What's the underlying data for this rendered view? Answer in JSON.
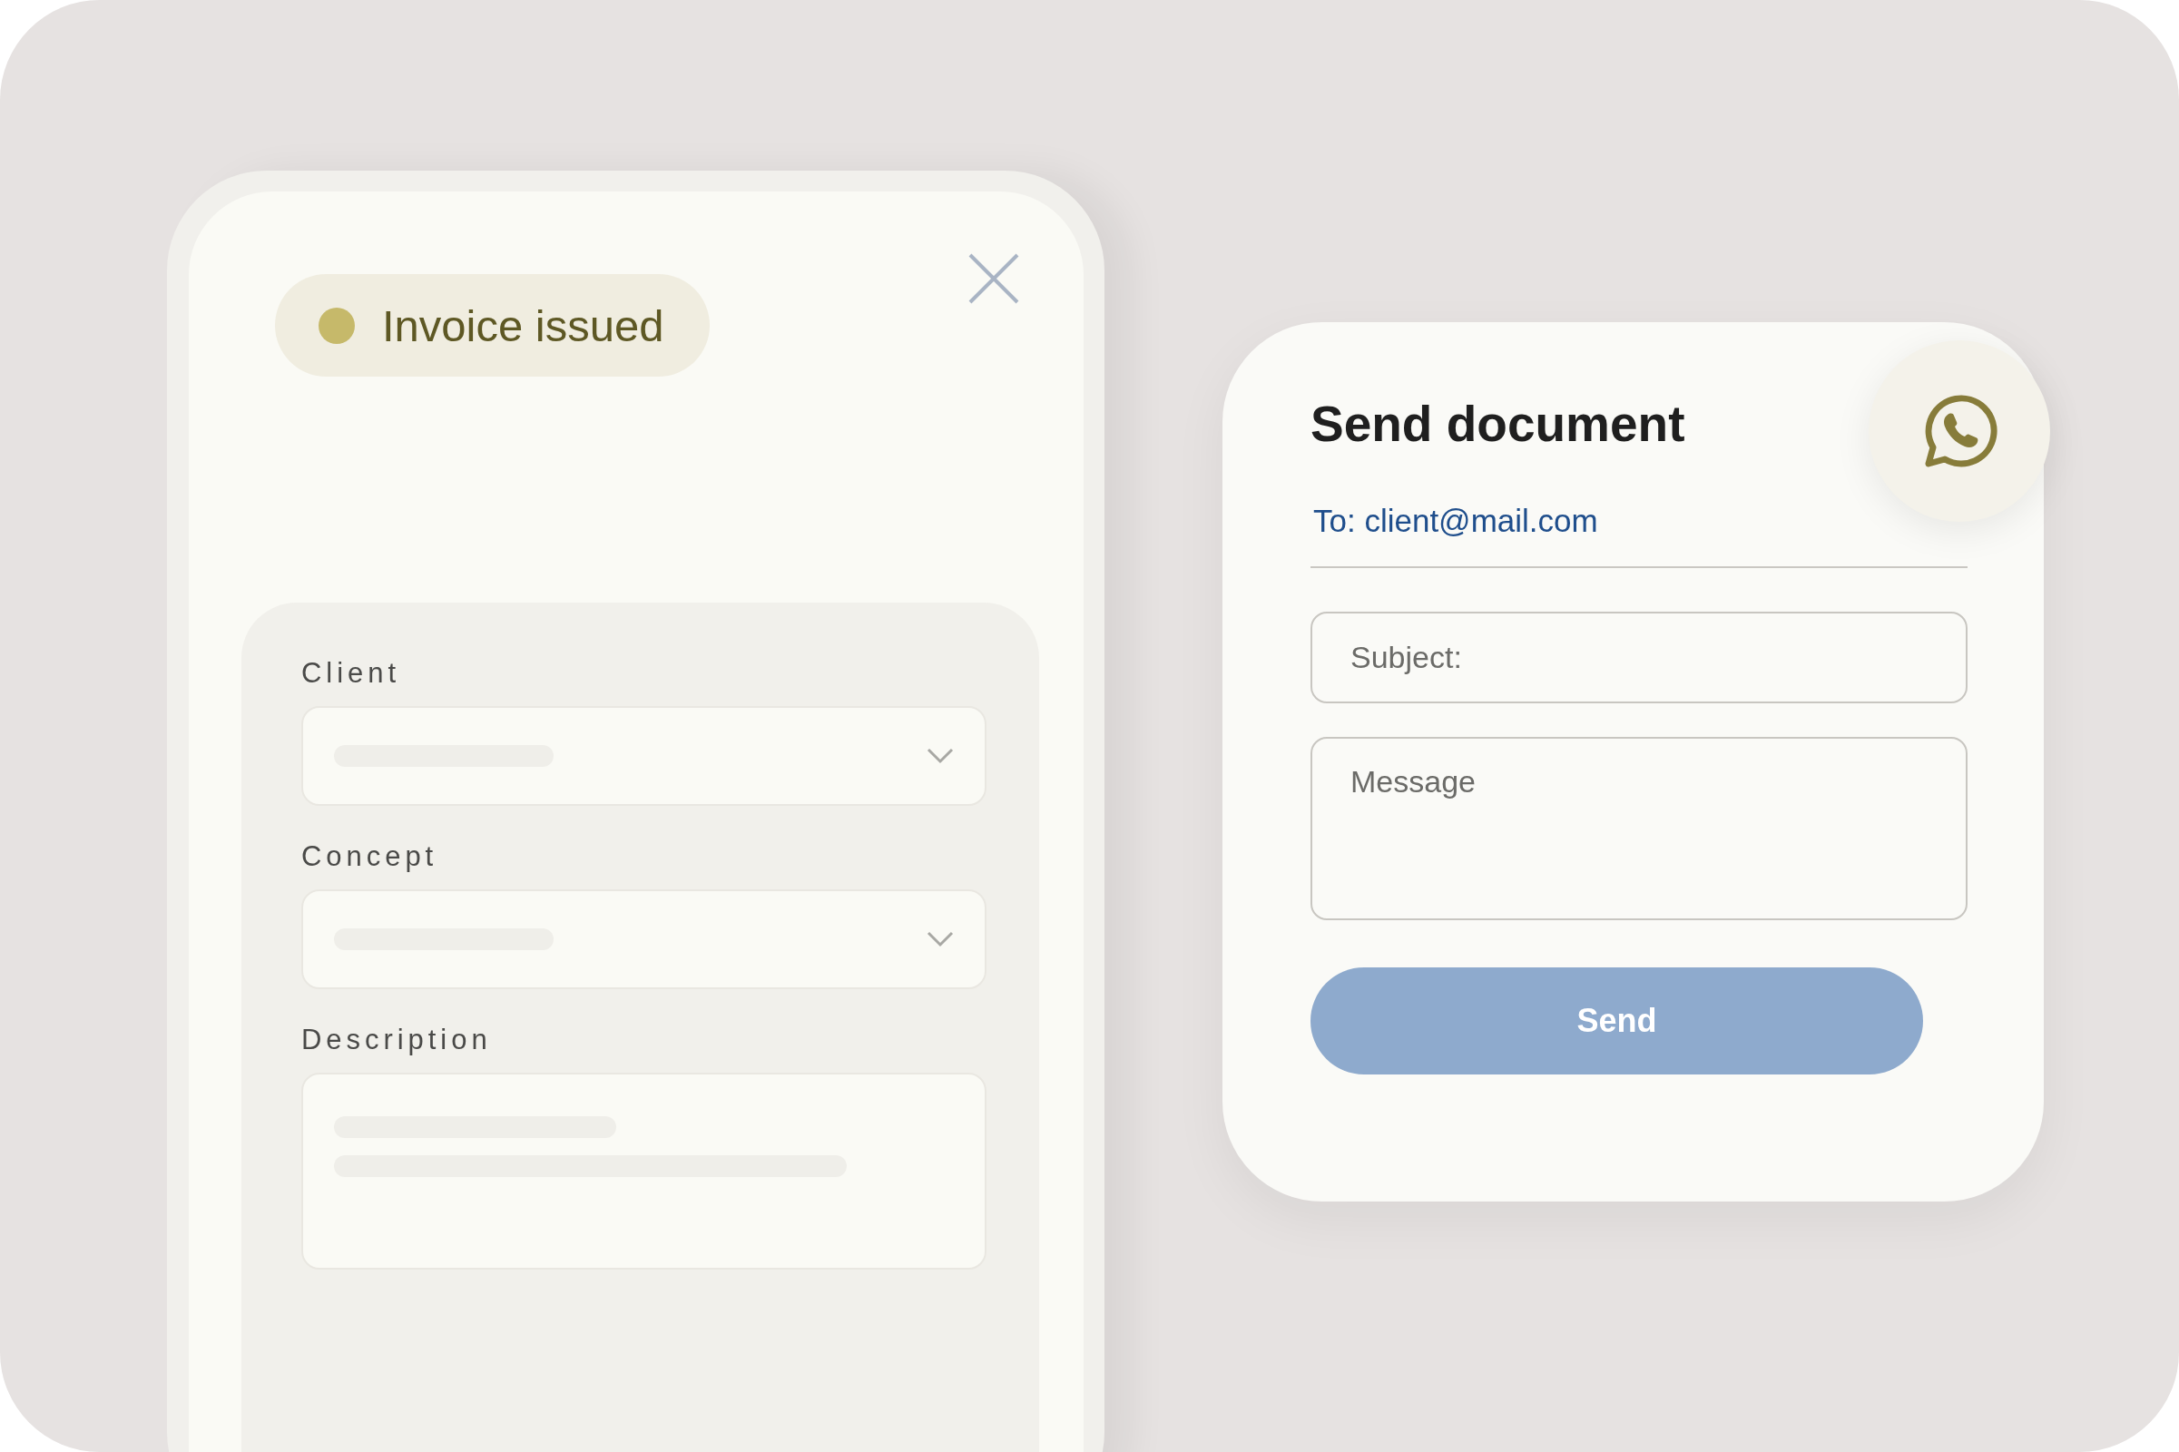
{
  "invoice_panel": {
    "status_badge": {
      "label": "Invoice issued"
    },
    "fields": [
      {
        "label": "Client",
        "kind": "select"
      },
      {
        "label": "Concept",
        "kind": "select"
      },
      {
        "label": "Description",
        "kind": "textarea"
      }
    ]
  },
  "send_card": {
    "title": "Send document",
    "recipient": "To: client@mail.com",
    "subject": {
      "placeholder": "Subject:"
    },
    "message": {
      "placeholder": "Message"
    },
    "send_button": "Send"
  }
}
